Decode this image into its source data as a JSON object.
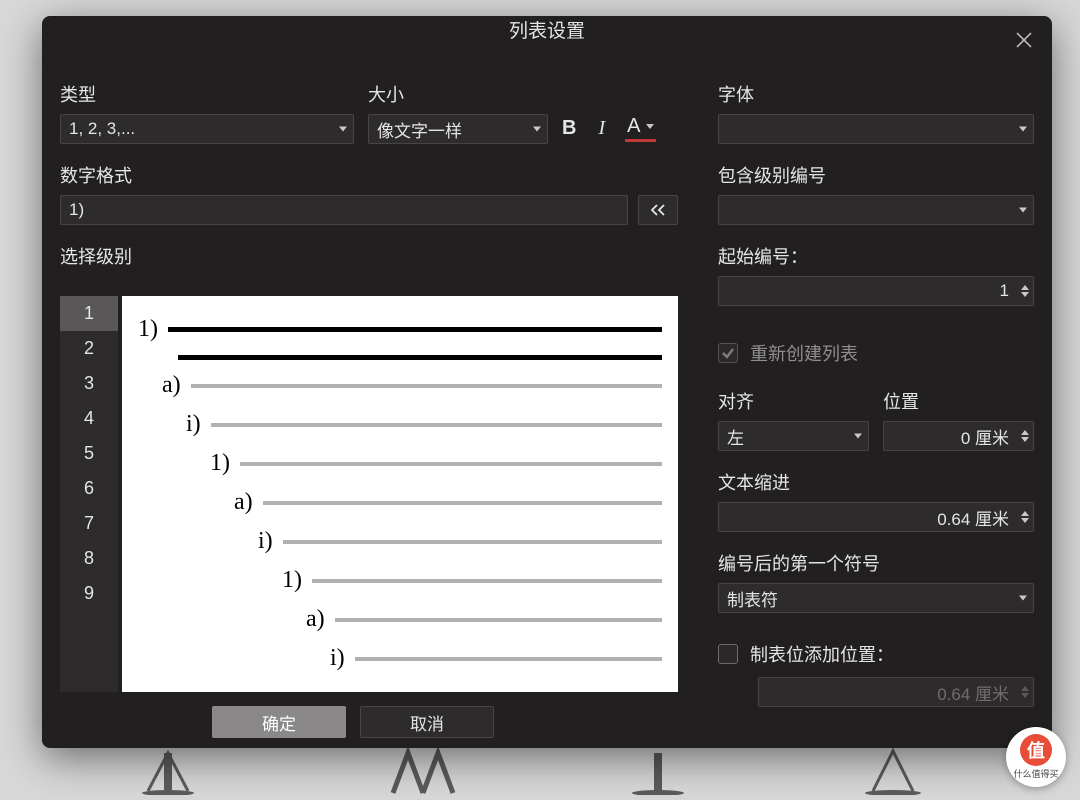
{
  "dialog_title": "列表设置",
  "type": {
    "label": "类型",
    "value": "1, 2, 3,..."
  },
  "size": {
    "label": "大小",
    "value": "像文字一样"
  },
  "format_buttons": {
    "bold": "B",
    "italic": "I",
    "underline": "A"
  },
  "font": {
    "label": "字体",
    "value": ""
  },
  "number_format": {
    "label": "数字格式",
    "value": "1)"
  },
  "select_level": {
    "label": "选择级别",
    "levels": [
      "1",
      "2",
      "3",
      "4",
      "5",
      "6",
      "7",
      "8",
      "9"
    ],
    "selected": "1"
  },
  "preview": [
    {
      "indent": 0,
      "label": "1)",
      "style": "black",
      "continuation": true
    },
    {
      "indent": 1,
      "label": "a)",
      "style": "gray"
    },
    {
      "indent": 2,
      "label": "i)",
      "style": "gray"
    },
    {
      "indent": 3,
      "label": "1)",
      "style": "gray"
    },
    {
      "indent": 4,
      "label": "a)",
      "style": "gray"
    },
    {
      "indent": 5,
      "label": "i)",
      "style": "gray"
    },
    {
      "indent": 6,
      "label": "1)",
      "style": "gray"
    },
    {
      "indent": 7,
      "label": "a)",
      "style": "gray"
    },
    {
      "indent": 8,
      "label": "i)",
      "style": "gray"
    }
  ],
  "include_level_number": {
    "label": "包含级别编号",
    "value": ""
  },
  "start_number": {
    "label": "起始编号：",
    "value": "1"
  },
  "recreate_list": {
    "label": "重新创建列表",
    "checked": true,
    "enabled": false
  },
  "alignment": {
    "label": "对齐",
    "value": "左"
  },
  "position": {
    "label": "位置",
    "value": "0 厘米"
  },
  "text_indent": {
    "label": "文本缩进",
    "value": "0.64 厘米"
  },
  "symbol_after": {
    "label": "编号后的第一个符号",
    "value": "制表符"
  },
  "tab_position": {
    "label": "制表位添加位置：",
    "value": "0.64 厘米",
    "checked": false
  },
  "buttons": {
    "ok": "确定",
    "cancel": "取消"
  },
  "watermark": {
    "char": "值",
    "text": "什么值得买"
  }
}
